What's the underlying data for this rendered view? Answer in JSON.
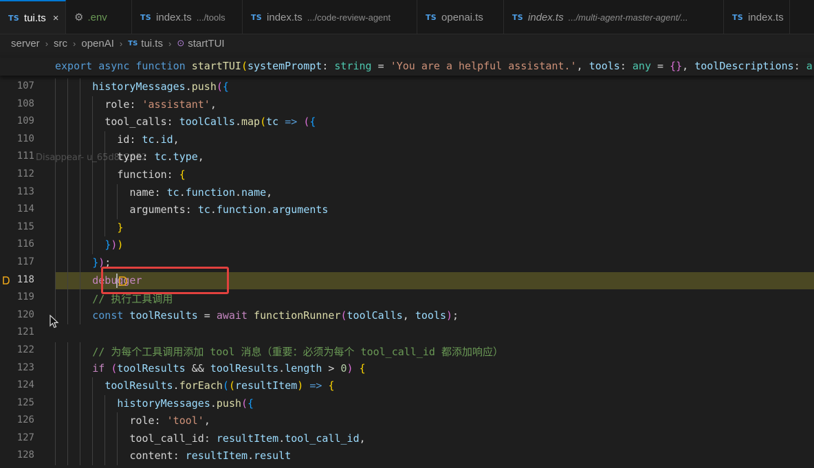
{
  "tabs": [
    {
      "label": "tui.ts",
      "desc": "",
      "kind": "ts",
      "active": true
    },
    {
      "label": ".env",
      "desc": "",
      "kind": "env",
      "active": false
    },
    {
      "label": "index.ts",
      "desc": ".../tools",
      "kind": "ts",
      "active": false
    },
    {
      "label": "index.ts",
      "desc": ".../code-review-agent",
      "kind": "ts",
      "active": false
    },
    {
      "label": "openai.ts",
      "desc": "",
      "kind": "ts",
      "active": false
    },
    {
      "label": "index.ts",
      "desc": ".../multi-agent-master-agent/...",
      "kind": "ts",
      "active": false,
      "italic": true
    },
    {
      "label": "index.ts",
      "desc": "",
      "kind": "ts",
      "active": false
    }
  ],
  "tab_badge": "TS",
  "tab_close": "×",
  "breadcrumb": {
    "items": [
      "server",
      "src",
      "openAI",
      "tui.ts",
      "startTUI"
    ],
    "separator": "›"
  },
  "sticky_header": [
    {
      "t": "export async function ",
      "c": "kw"
    },
    {
      "t": "startTUI",
      "c": "fn"
    },
    {
      "t": "(",
      "c": "p1"
    },
    {
      "t": "systemPrompt",
      "c": "var"
    },
    {
      "t": ": ",
      "c": "plain"
    },
    {
      "t": "string",
      "c": "ty"
    },
    {
      "t": " = ",
      "c": "plain"
    },
    {
      "t": "'You are a helpful assistant.'",
      "c": "str"
    },
    {
      "t": ", ",
      "c": "plain"
    },
    {
      "t": "tools",
      "c": "var"
    },
    {
      "t": ": ",
      "c": "plain"
    },
    {
      "t": "any",
      "c": "ty"
    },
    {
      "t": " = ",
      "c": "plain"
    },
    {
      "t": "{}",
      "c": "p2"
    },
    {
      "t": ", ",
      "c": "plain"
    },
    {
      "t": "toolDescriptions",
      "c": "var"
    },
    {
      "t": ": ",
      "c": "plain"
    },
    {
      "t": "ar",
      "c": "ty"
    }
  ],
  "lines": [
    {
      "n": "107",
      "indent": 6,
      "tokens": [
        {
          "t": "historyMessages",
          "c": "var"
        },
        {
          "t": ".",
          "c": "plain"
        },
        {
          "t": "push",
          "c": "fn"
        },
        {
          "t": "(",
          "c": "p2"
        },
        {
          "t": "{",
          "c": "p3"
        }
      ]
    },
    {
      "n": "108",
      "indent": 8,
      "tokens": [
        {
          "t": "role",
          "c": "prop"
        },
        {
          "t": ": ",
          "c": "plain"
        },
        {
          "t": "'assistant'",
          "c": "str"
        },
        {
          "t": ",",
          "c": "plain"
        }
      ]
    },
    {
      "n": "109",
      "indent": 8,
      "tokens": [
        {
          "t": "tool_calls",
          "c": "prop"
        },
        {
          "t": ": ",
          "c": "plain"
        },
        {
          "t": "toolCalls",
          "c": "var"
        },
        {
          "t": ".",
          "c": "plain"
        },
        {
          "t": "map",
          "c": "fn"
        },
        {
          "t": "(",
          "c": "p1"
        },
        {
          "t": "tc",
          "c": "var"
        },
        {
          "t": " ",
          "c": "plain"
        },
        {
          "t": "=>",
          "c": "kw"
        },
        {
          "t": " ",
          "c": "plain"
        },
        {
          "t": "(",
          "c": "p2"
        },
        {
          "t": "{",
          "c": "p3"
        }
      ]
    },
    {
      "n": "110",
      "indent": 10,
      "tokens": [
        {
          "t": "id",
          "c": "prop"
        },
        {
          "t": ": ",
          "c": "plain"
        },
        {
          "t": "tc",
          "c": "var"
        },
        {
          "t": ".",
          "c": "plain"
        },
        {
          "t": "id",
          "c": "var"
        },
        {
          "t": ",",
          "c": "plain"
        }
      ]
    },
    {
      "n": "111",
      "indent": 10,
      "tokens": [
        {
          "t": "type",
          "c": "prop"
        },
        {
          "t": ": ",
          "c": "plain"
        },
        {
          "t": "tc",
          "c": "var"
        },
        {
          "t": ".",
          "c": "plain"
        },
        {
          "t": "type",
          "c": "var"
        },
        {
          "t": ",",
          "c": "plain"
        }
      ]
    },
    {
      "n": "112",
      "indent": 10,
      "tokens": [
        {
          "t": "function",
          "c": "prop"
        },
        {
          "t": ": ",
          "c": "plain"
        },
        {
          "t": "{",
          "c": "p1"
        }
      ]
    },
    {
      "n": "113",
      "indent": 12,
      "tokens": [
        {
          "t": "name",
          "c": "prop"
        },
        {
          "t": ": ",
          "c": "plain"
        },
        {
          "t": "tc",
          "c": "var"
        },
        {
          "t": ".",
          "c": "plain"
        },
        {
          "t": "function",
          "c": "var"
        },
        {
          "t": ".",
          "c": "plain"
        },
        {
          "t": "name",
          "c": "var"
        },
        {
          "t": ",",
          "c": "plain"
        }
      ]
    },
    {
      "n": "114",
      "indent": 12,
      "tokens": [
        {
          "t": "arguments",
          "c": "prop"
        },
        {
          "t": ": ",
          "c": "plain"
        },
        {
          "t": "tc",
          "c": "var"
        },
        {
          "t": ".",
          "c": "plain"
        },
        {
          "t": "function",
          "c": "var"
        },
        {
          "t": ".",
          "c": "plain"
        },
        {
          "t": "arguments",
          "c": "var"
        }
      ]
    },
    {
      "n": "115",
      "indent": 10,
      "tokens": [
        {
          "t": "}",
          "c": "p1"
        }
      ]
    },
    {
      "n": "116",
      "indent": 8,
      "tokens": [
        {
          "t": "}",
          "c": "p3"
        },
        {
          "t": ")",
          "c": "p2"
        },
        {
          "t": ")",
          "c": "p1"
        }
      ]
    },
    {
      "n": "117",
      "indent": 6,
      "tokens": [
        {
          "t": "}",
          "c": "p3"
        },
        {
          "t": ")",
          "c": "p2"
        },
        {
          "t": ";",
          "c": "plain"
        }
      ]
    },
    {
      "n": "118",
      "indent": 6,
      "highlight": true,
      "breakpoint": true,
      "tokens": [
        {
          "t": "debugger",
          "c": "dbg"
        }
      ]
    },
    {
      "n": "119",
      "indent": 6,
      "tokens": [
        {
          "t": "// 执行工具调用",
          "c": "cm"
        }
      ]
    },
    {
      "n": "120",
      "indent": 6,
      "tokens": [
        {
          "t": "const",
          "c": "kw"
        },
        {
          "t": " ",
          "c": "plain"
        },
        {
          "t": "toolResults",
          "c": "var"
        },
        {
          "t": " = ",
          "c": "plain"
        },
        {
          "t": "await",
          "c": "kwc"
        },
        {
          "t": " ",
          "c": "plain"
        },
        {
          "t": "functionRunner",
          "c": "fn"
        },
        {
          "t": "(",
          "c": "p2"
        },
        {
          "t": "toolCalls",
          "c": "var"
        },
        {
          "t": ", ",
          "c": "plain"
        },
        {
          "t": "tools",
          "c": "var"
        },
        {
          "t": ")",
          "c": "p2"
        },
        {
          "t": ";",
          "c": "plain"
        }
      ]
    },
    {
      "n": "121",
      "indent": 0,
      "tokens": []
    },
    {
      "n": "122",
      "indent": 6,
      "tokens": [
        {
          "t": "// 为每个工具调用添加 tool 消息（重要：必须为每个 tool_call_id 都添加响应）",
          "c": "cm"
        }
      ]
    },
    {
      "n": "123",
      "indent": 6,
      "tokens": [
        {
          "t": "if",
          "c": "kwc"
        },
        {
          "t": " ",
          "c": "plain"
        },
        {
          "t": "(",
          "c": "p2"
        },
        {
          "t": "toolResults",
          "c": "var"
        },
        {
          "t": " && ",
          "c": "plain"
        },
        {
          "t": "toolResults",
          "c": "var"
        },
        {
          "t": ".",
          "c": "plain"
        },
        {
          "t": "length",
          "c": "var"
        },
        {
          "t": " > ",
          "c": "plain"
        },
        {
          "t": "0",
          "c": "num"
        },
        {
          "t": ")",
          "c": "p2"
        },
        {
          "t": " ",
          "c": "plain"
        },
        {
          "t": "{",
          "c": "p1"
        }
      ]
    },
    {
      "n": "124",
      "indent": 8,
      "tokens": [
        {
          "t": "toolResults",
          "c": "var"
        },
        {
          "t": ".",
          "c": "plain"
        },
        {
          "t": "forEach",
          "c": "fn"
        },
        {
          "t": "(",
          "c": "p3"
        },
        {
          "t": "(",
          "c": "p1"
        },
        {
          "t": "resultItem",
          "c": "var"
        },
        {
          "t": ")",
          "c": "p1"
        },
        {
          "t": " ",
          "c": "plain"
        },
        {
          "t": "=>",
          "c": "kw"
        },
        {
          "t": " ",
          "c": "plain"
        },
        {
          "t": "{",
          "c": "p1"
        }
      ]
    },
    {
      "n": "125",
      "indent": 10,
      "tokens": [
        {
          "t": "historyMessages",
          "c": "var"
        },
        {
          "t": ".",
          "c": "plain"
        },
        {
          "t": "push",
          "c": "fn"
        },
        {
          "t": "(",
          "c": "p2"
        },
        {
          "t": "{",
          "c": "p3"
        }
      ]
    },
    {
      "n": "126",
      "indent": 12,
      "tokens": [
        {
          "t": "role",
          "c": "prop"
        },
        {
          "t": ": ",
          "c": "plain"
        },
        {
          "t": "'tool'",
          "c": "str"
        },
        {
          "t": ",",
          "c": "plain"
        }
      ]
    },
    {
      "n": "127",
      "indent": 12,
      "tokens": [
        {
          "t": "tool_call_id",
          "c": "prop"
        },
        {
          "t": ": ",
          "c": "plain"
        },
        {
          "t": "resultItem",
          "c": "var"
        },
        {
          "t": ".",
          "c": "plain"
        },
        {
          "t": "tool_call_id",
          "c": "var"
        },
        {
          "t": ",",
          "c": "plain"
        }
      ]
    },
    {
      "n": "128",
      "indent": 12,
      "tokens": [
        {
          "t": "content",
          "c": "prop"
        },
        {
          "t": ": ",
          "c": "plain"
        },
        {
          "t": "resultItem",
          "c": "var"
        },
        {
          "t": ".",
          "c": "plain"
        },
        {
          "t": "result",
          "c": "var"
        }
      ]
    }
  ],
  "watermark": "Disappear- u_65d8c2952",
  "colors": {
    "accent": "#0078d4",
    "highlight_line": "#4b4823",
    "annotation_box": "#e2413e",
    "breakpoint": "#e8a419"
  }
}
